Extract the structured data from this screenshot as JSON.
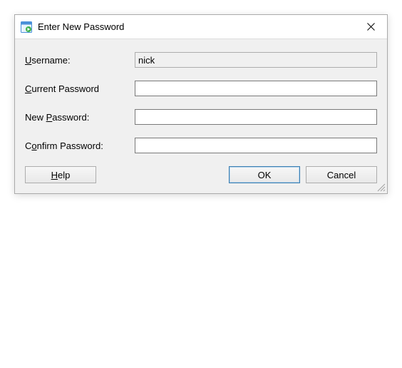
{
  "titlebar": {
    "title": "Enter New Password"
  },
  "form": {
    "username_label_pre": "",
    "username_mnemonic": "U",
    "username_label_post": "sername:",
    "username_value": "nick",
    "current_label_pre": "",
    "current_mnemonic": "C",
    "current_label_post": "urrent Password",
    "current_value": "",
    "new_label_pre": "New ",
    "new_mnemonic": "P",
    "new_label_post": "assword:",
    "new_value": "",
    "confirm_label_pre": "C",
    "confirm_mnemonic": "o",
    "confirm_label_post": "nfirm Password:",
    "confirm_value": ""
  },
  "buttons": {
    "help_pre": "",
    "help_mnemonic": "H",
    "help_post": "elp",
    "ok": "OK",
    "cancel": "Cancel"
  }
}
